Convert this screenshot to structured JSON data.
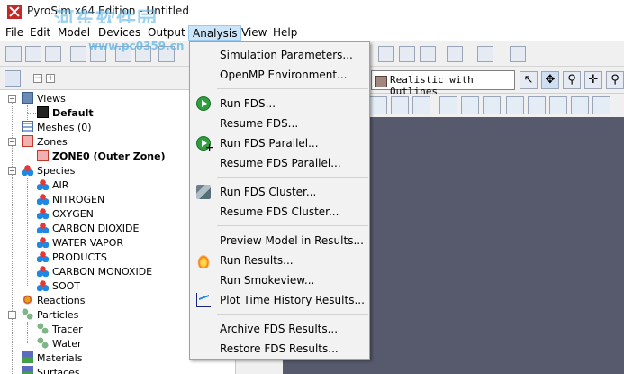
{
  "window": {
    "title": "PyroSim x64 Edition - Untitled"
  },
  "watermark": {
    "text": "河东软件园",
    "url": "www.pc0359.cn"
  },
  "menubar": {
    "items": [
      "File",
      "Edit",
      "Model",
      "Devices",
      "Output",
      "Analysis",
      "View",
      "Help"
    ],
    "active": "Analysis"
  },
  "viewport": {
    "render_mode": "Realistic with Outlines",
    "canvas_color": "#565a6c"
  },
  "tree": {
    "views": "Views",
    "default_view": "Default",
    "meshes": "Meshes (0)",
    "zones": "Zones",
    "zone0": "ZONE0 (Outer Zone)",
    "species": "Species",
    "species_items": [
      "AIR",
      "NITROGEN",
      "OXYGEN",
      "CARBON DIOXIDE",
      "WATER VAPOR",
      "PRODUCTS",
      "CARBON MONOXIDE",
      "SOOT"
    ],
    "reactions": "Reactions",
    "particles": "Particles",
    "particle_items": [
      "Tracer",
      "Water"
    ],
    "materials": "Materials",
    "surfaces": "Surfaces"
  },
  "analysis_menu": {
    "items": [
      {
        "label": "Simulation Parameters...",
        "icon": "none"
      },
      {
        "label": "OpenMP Environment...",
        "icon": "none"
      },
      {
        "label": "Run FDS...",
        "icon": "play-icon"
      },
      {
        "label": "Resume FDS...",
        "icon": "none"
      },
      {
        "label": "Run FDS Parallel...",
        "icon": "play-parallel-icon"
      },
      {
        "label": "Resume FDS Parallel...",
        "icon": "none"
      },
      {
        "label": "Run FDS Cluster...",
        "icon": "cluster-icon"
      },
      {
        "label": "Resume FDS Cluster...",
        "icon": "none"
      },
      {
        "label": "Preview Model in Results...",
        "icon": "none"
      },
      {
        "label": "Run Results...",
        "icon": "fire-icon"
      },
      {
        "label": "Run Smokeview...",
        "icon": "none"
      },
      {
        "label": "Plot Time History Results...",
        "icon": "plot-icon"
      },
      {
        "label": "Archive FDS Results...",
        "icon": "none"
      },
      {
        "label": "Restore FDS Results...",
        "icon": "none"
      }
    ]
  }
}
